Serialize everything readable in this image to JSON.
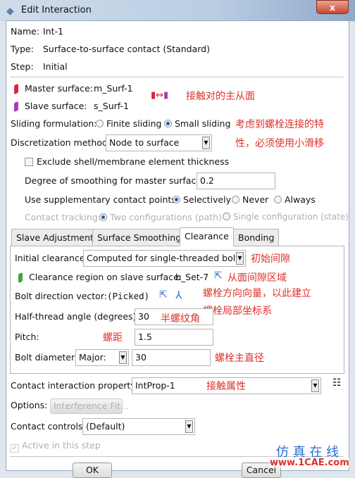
{
  "window": {
    "title": "Edit Interaction",
    "close": "x"
  },
  "info": {
    "name_label": "Name:",
    "name": "Int-1",
    "type_label": "Type:",
    "type": "Surface-to-surface contact (Standard)",
    "step_label": "Step:",
    "step": "Initial"
  },
  "master": {
    "label": "Master surface:",
    "value": "m_Surf-1",
    "color": "#d8263a"
  },
  "slave": {
    "label": "Slave surface:",
    "value": "s_Surf-1",
    "color": "#b03ab8"
  },
  "sliding": {
    "label": "Sliding formulation:",
    "options": [
      "Finite sliding",
      "Small sliding"
    ],
    "selected": "Small sliding"
  },
  "discretization": {
    "label": "Discretization method:",
    "value": "Node to surface"
  },
  "exclude_thickness": {
    "label": "Exclude shell/membrane element thickness",
    "checked": false
  },
  "smoothing": {
    "label": "Degree of smoothing for master surface:",
    "value": "0.2"
  },
  "supplementary": {
    "label": "Use supplementary contact points:",
    "options": [
      "Selectively",
      "Never",
      "Always"
    ],
    "selected": "Selectively"
  },
  "tracking": {
    "label": "Contact tracking:",
    "options": [
      "Two configurations (path)",
      "Single configuration (state)"
    ],
    "selected": "Two configurations (path)",
    "disabled": true
  },
  "tabs": [
    {
      "label": "Slave Adjustment"
    },
    {
      "label": "Surface Smoothing"
    },
    {
      "label": "Clearance",
      "active": true
    },
    {
      "label": "Bonding"
    }
  ],
  "clearance": {
    "initial_label": "Initial clearance:",
    "initial_value": "Computed for single-threaded bolt",
    "region_label": "Clearance region on slave surface:",
    "region_value": "b_Set-7",
    "bolt_dir_label": "Bolt direction vector:",
    "bolt_dir_value": "(Picked)",
    "half_thread_label": "Half-thread angle (degrees):",
    "half_thread_value": "30",
    "pitch_label": "Pitch:",
    "pitch_value": "1.5",
    "diameter_label": "Bolt diameter:",
    "diameter_type": "Major:",
    "diameter_value": "30"
  },
  "property": {
    "label": "Contact interaction property:",
    "value": "IntProp-1"
  },
  "options": {
    "label": "Options:",
    "button": "Interference Fit..."
  },
  "controls": {
    "label": "Contact controls:",
    "value": "(Default)"
  },
  "active": {
    "label": "Active in this step",
    "checked": true
  },
  "buttons": {
    "ok": "OK",
    "cancel": "Cancel"
  },
  "annotations": {
    "surfaces": "接触对的主从面",
    "sliding1": "考虑到螺栓连接的特",
    "sliding2": "性，必须使用小滑移",
    "initial": "初始间隙",
    "region": "从面间隙区域",
    "bolt1": "螺栓方向向量，以此建立",
    "bolt2": "螺栓局部坐标系",
    "half": "半螺纹角",
    "pitch": "螺距",
    "diameter": "螺栓主直径",
    "property": "接触属性"
  },
  "watermark": {
    "cn": "仿 真 在 线",
    "url": "www.1CAE.com"
  }
}
